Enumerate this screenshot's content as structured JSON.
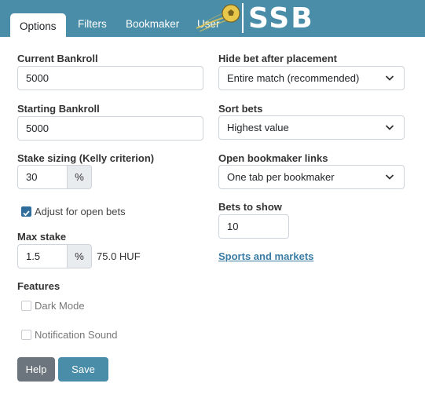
{
  "tabs": [
    {
      "label": "Options",
      "active": true
    },
    {
      "label": "Filters"
    },
    {
      "label": "Bookmaker"
    },
    {
      "label": "User"
    }
  ],
  "logo": {
    "text": "SSB",
    "icon": "soccer-ball-logo-icon"
  },
  "colors": {
    "header": "#4a8da8",
    "checkbox_checked": "#2f6e9a",
    "help_button": "#6c757d",
    "save_button": "#4a8da8",
    "link": "#3a7ca5"
  },
  "left": {
    "current_bankroll": {
      "label": "Current Bankroll",
      "value": "5000"
    },
    "starting_bankroll": {
      "label": "Starting Bankroll",
      "value": "5000"
    },
    "stake_sizing": {
      "label": "Stake sizing (Kelly criterion)",
      "value": "30",
      "unit": "%"
    },
    "adjust_open_bets": {
      "label": "Adjust for open bets",
      "checked": true
    },
    "max_stake": {
      "label": "Max stake",
      "value": "1.5",
      "unit": "%",
      "converted": "75.0 HUF"
    },
    "features": {
      "label": "Features",
      "dark_mode": {
        "label": "Dark Mode",
        "checked": false
      },
      "notification_sound": {
        "label": "Notification Sound",
        "checked": false
      }
    }
  },
  "right": {
    "hide_bet": {
      "label": "Hide bet after placement",
      "value": "Entire match (recommended)"
    },
    "sort_bets": {
      "label": "Sort bets",
      "value": "Highest value"
    },
    "open_links": {
      "label": "Open bookmaker links",
      "value": "One tab per bookmaker"
    },
    "bets_to_show": {
      "label": "Bets to show",
      "value": "10"
    },
    "sports_link": "Sports and markets"
  },
  "buttons": {
    "help": "Help",
    "save": "Save"
  }
}
